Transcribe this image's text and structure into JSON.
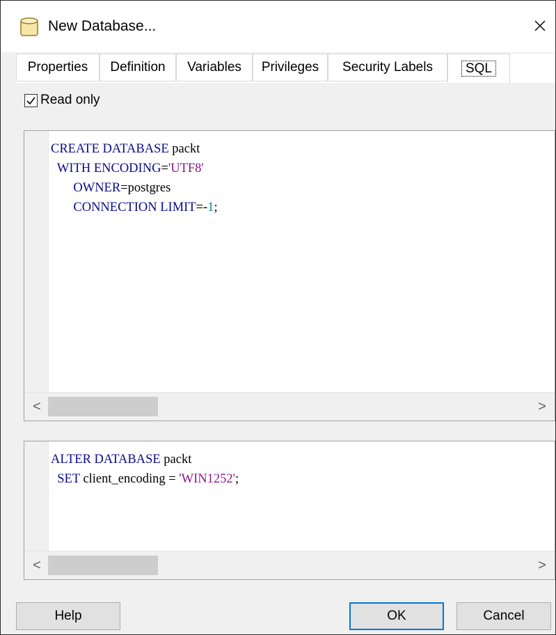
{
  "window": {
    "title": "New Database...",
    "close_glyph": "✕",
    "icon": "database-icon"
  },
  "tabs": [
    {
      "label": "Properties",
      "active": false
    },
    {
      "label": "Definition",
      "active": false
    },
    {
      "label": "Variables",
      "active": false
    },
    {
      "label": "Privileges",
      "active": false
    },
    {
      "label": "Security Labels",
      "active": false
    },
    {
      "label": "SQL",
      "active": true
    }
  ],
  "read_only": {
    "label": "Read only",
    "checked": true
  },
  "sql_editor": {
    "lines": [
      [
        {
          "t": "CREATE DATABASE",
          "c": "kw"
        },
        {
          "t": " packt",
          "c": ""
        }
      ],
      [
        {
          "t": "  WITH ENCODING",
          "c": "kw"
        },
        {
          "t": "=",
          "c": ""
        },
        {
          "t": "'UTF8'",
          "c": "str"
        }
      ],
      [
        {
          "t": "       OWNER",
          "c": "kw"
        },
        {
          "t": "=postgres",
          "c": ""
        }
      ],
      [
        {
          "t": "       CONNECTION LIMIT",
          "c": "kw"
        },
        {
          "t": "=-",
          "c": ""
        },
        {
          "t": "1",
          "c": "num"
        },
        {
          "t": ";",
          "c": ""
        }
      ]
    ]
  },
  "alter_editor": {
    "lines": [
      [
        {
          "t": "ALTER DATABASE",
          "c": "kw"
        },
        {
          "t": " packt",
          "c": ""
        }
      ],
      [
        {
          "t": "  SET",
          "c": "kw"
        },
        {
          "t": " client_encoding = ",
          "c": ""
        },
        {
          "t": "'WIN1252'",
          "c": "str"
        },
        {
          "t": ";",
          "c": ""
        }
      ]
    ]
  },
  "scroll_arrows": {
    "left": "<",
    "right": ">"
  },
  "buttons": {
    "help": "Help",
    "ok": "OK",
    "cancel": "Cancel"
  },
  "colors": {
    "keyword": "#0b0b8a",
    "string": "#8a168a",
    "number": "#0a8a8a",
    "default_button_border": "#0078d7"
  }
}
